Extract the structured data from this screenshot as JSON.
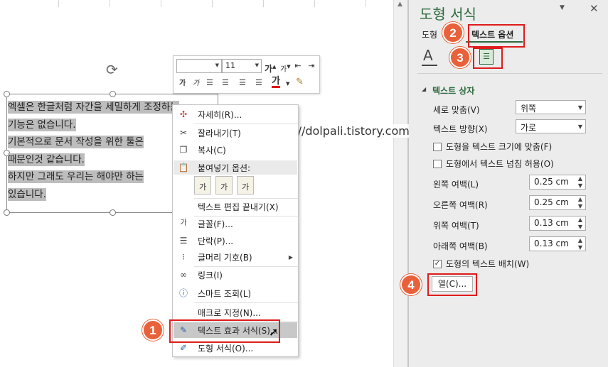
{
  "shape_text": {
    "lines": [
      "엑셀은 한글처럼 자간을 세밀하게 조정하는",
      "기능은 없습니다.",
      "기본적으로 문서 작성을 위한 툴은",
      "때문인것 같습니다.",
      "하지만 그래도 우리는 해야만 하는",
      "있습니다."
    ]
  },
  "mini_toolbar": {
    "font_size": "11",
    "grow_font": "가",
    "shrink_font": "가",
    "bold": "가",
    "italic": "가",
    "font_color": "가"
  },
  "watermark": "https://dolpali.tistory.com",
  "context_menu": {
    "items": [
      {
        "label": "자세히(R)...",
        "icon": "smart-lookup-icon"
      },
      {
        "label": "잘라내기(T)",
        "icon": "scissors-icon"
      },
      {
        "label": "복사(C)",
        "icon": "copy-icon"
      },
      {
        "label": "붙여넣기 옵션:",
        "icon": "clipboard-icon"
      },
      {
        "label": "텍스트 편집 끝내기(X)",
        "icon": ""
      },
      {
        "label": "글꼴(F)...",
        "icon": "font-icon"
      },
      {
        "label": "단락(P)...",
        "icon": "paragraph-icon"
      },
      {
        "label": "글머리 기호(B)",
        "icon": "bullets-icon"
      },
      {
        "label": "링크(I)",
        "icon": "link-icon"
      },
      {
        "label": "스마트 조회(L)",
        "icon": "info-icon"
      },
      {
        "label": "매크로 지정(N)...",
        "icon": ""
      },
      {
        "label": "텍스트 효과 서식(S)...",
        "icon": "text-effects-icon"
      },
      {
        "label": "도형 서식(O)...",
        "icon": "shape-format-icon"
      }
    ],
    "paste_glyph": "가"
  },
  "callouts": [
    "1",
    "2",
    "3",
    "4"
  ],
  "panel": {
    "title": "도형 서식",
    "tab_shape": "도형",
    "tab_text": "텍스트 옵션",
    "text_icon_glyph": "A",
    "section": "텍스트 상자",
    "vertical_align_label": "세로 맞춤(V)",
    "vertical_align_value": "위쪽",
    "text_direction_label": "텍스트 방향(X)",
    "text_direction_value": "가로",
    "resize_label": "도형을 텍스트 크기에 맞춤(F)",
    "overflow_label": "도형에서 텍스트 넘침 허용(O)",
    "left_margin_label": "왼쪽 여백(L)",
    "left_margin_value": "0.25 cm",
    "right_margin_label": "오른쪽 여백(R)",
    "right_margin_value": "0.25 cm",
    "top_margin_label": "위쪽 여백(T)",
    "top_margin_value": "0.13 cm",
    "bottom_margin_label": "아래쪽 여백(B)",
    "bottom_margin_value": "0.13 cm",
    "wrap_label": "도형의 텍스트 배치(W)",
    "columns_button": "열(C)..."
  },
  "colors": {
    "accent": "#2d6a3e",
    "callout": "#e8613a",
    "highlight_box": "#e01b1b"
  }
}
